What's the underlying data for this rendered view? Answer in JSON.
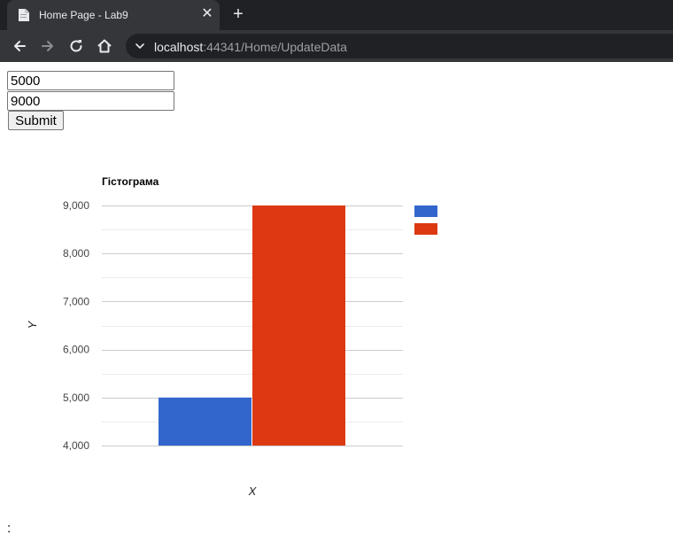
{
  "browser": {
    "tab_title": "Home Page - Lab9",
    "url_host": "localhost",
    "url_rest": ":44341/Home/UpdateData"
  },
  "form": {
    "value1": "5000",
    "value2": "9000",
    "submit_label": "Submit"
  },
  "chart_data": {
    "type": "bar",
    "title": "Гістограма",
    "xlabel": "X",
    "ylabel": "Y",
    "ylim": [
      4000,
      9000
    ],
    "yticks": [
      "9,000",
      "8,000",
      "7,000",
      "6,000",
      "5,000",
      "4,000"
    ],
    "categories": [
      ""
    ],
    "series": [
      {
        "color": "#3366cc",
        "values": [
          5000
        ]
      },
      {
        "color": "#dc3912",
        "values": [
          9000
        ]
      }
    ],
    "grid": true,
    "legend": "right"
  },
  "trailing_text": ":"
}
